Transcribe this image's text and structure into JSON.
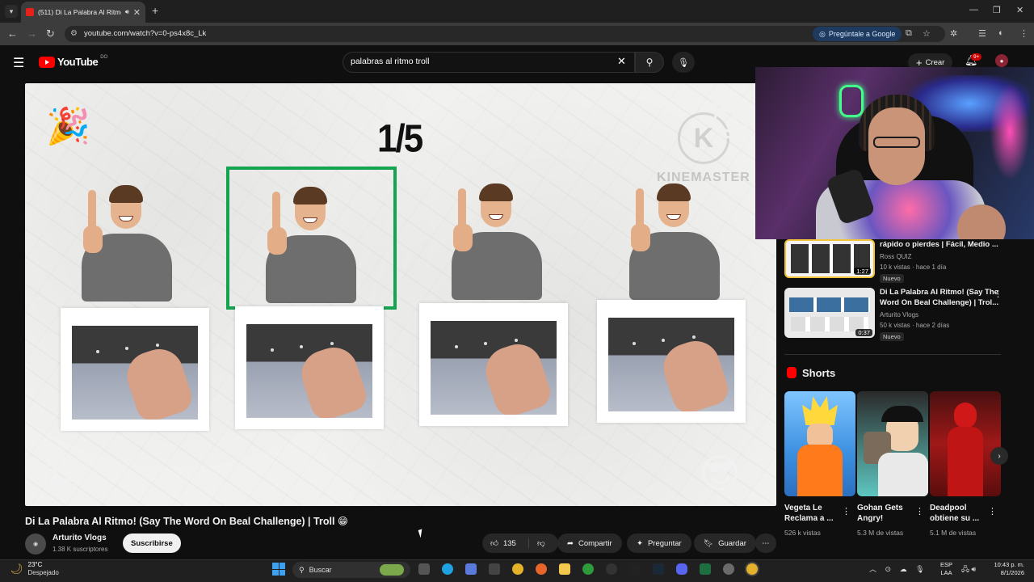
{
  "browser": {
    "tab_title": "(511) Di La Palabra Al Ritmo",
    "url": "youtube.com/watch?v=0-ps4x8c_Lk",
    "ask_google": "Pregúntale a Google"
  },
  "youtube": {
    "logo_text": "YouTube",
    "logo_country": "DO",
    "search_value": "palabras al ritmo troll",
    "create_label": "Crear",
    "notifications_badge": "9+"
  },
  "video": {
    "counter": "1/5",
    "watermark": "KINEMASTER",
    "watermark_letter": "K",
    "title": "Di La Palabra Al Ritmo! (Say The Word On Beal Challenge) | Troll 😁",
    "channel_name": "Arturito Vlogs",
    "subscribers": "1.38 K suscriptores",
    "subscribe_label": "Suscribirse",
    "likes": "135",
    "share_label": "Compartir",
    "ask_label": "Preguntar",
    "save_label": "Guardar"
  },
  "recommended": [
    {
      "title_line1": "rápido o pierdes | Fácil, Medio ...",
      "channel": "Ross QUIZ",
      "meta": "10 k vistas · hace 1 día",
      "badge": "Nuevo",
      "duration": "1:27"
    },
    {
      "title_line1": "Di La Palabra Al Ritmo! (Say The",
      "title_line2": "Word On Beal Challenge) | Trol...",
      "channel": "Arturito Vlogs",
      "meta": "50 k vistas · hace 2 días",
      "badge": "Nuevo",
      "duration": "0:37"
    }
  ],
  "shorts": {
    "heading": "Shorts",
    "items": [
      {
        "title_line1": "Vegeta Le",
        "title_line2": "Reclama a ...",
        "views": "526 k vistas"
      },
      {
        "title_line1": "Gohan Gets",
        "title_line2": "Angry!",
        "views": "5.3 M de vistas"
      },
      {
        "title_line1": "Deadpool",
        "title_line2": "obtiene su ...",
        "views": "5.1 M de vistas"
      }
    ]
  },
  "taskbar": {
    "temp": "23°C",
    "weather": "Despejado",
    "search_label": "Buscar",
    "lang_line1": "ESP",
    "lang_line2": "LAA",
    "time": "10:43 p. m.",
    "date": "8/1/2026"
  },
  "colors": {
    "yt_red": "#ff0000",
    "highlight_green": "#14a34e",
    "bg": "#0f0f0f"
  }
}
